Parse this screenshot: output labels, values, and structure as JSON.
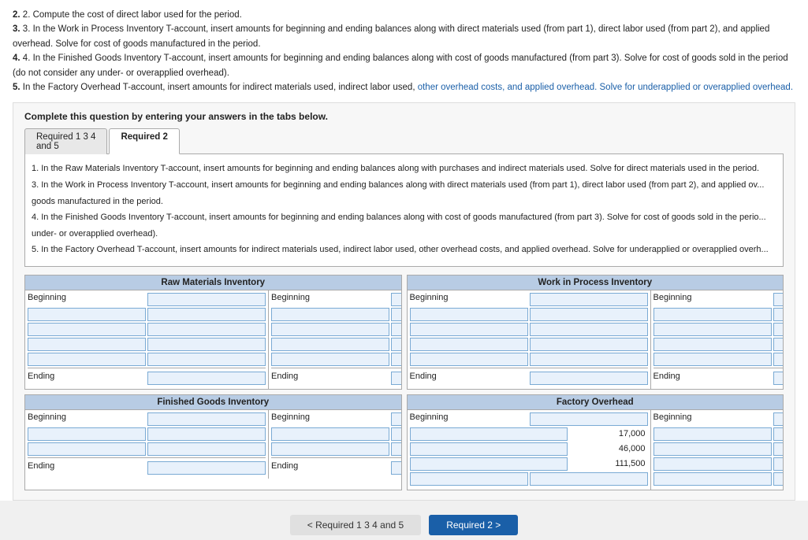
{
  "intro": {
    "line2": "2. Compute the cost of direct labor used for the period.",
    "line3": "3. In the Work in Process Inventory T-account, insert amounts for beginning and ending balances along with direct materials used (from part 1), direct labor used (from part 2), and applied overhead. Solve for cost of goods manufactured in the period.",
    "line4": "4. In the Finished Goods Inventory T-account, insert amounts for beginning and ending balances along with cost of goods manufactured (from part 3). Solve for cost of goods sold in the period (do not consider any under- or overapplied overhead).",
    "line5_start": "5. In the Factory Overhead T-account, insert amounts for indirect materials used, indirect labor used, ",
    "line5_blue": "other overhead costs, and applied overhead.",
    "line5_end": " Solve for underapplied or overapplied overhead."
  },
  "complete": {
    "label": "Complete this question by entering your answers in the tabs below."
  },
  "tabs": {
    "tab1": {
      "label": "Required 1 3 4\nand 5",
      "id": "tab1"
    },
    "tab2": {
      "label": "Required 2",
      "id": "tab2",
      "active": true
    }
  },
  "tab_content": {
    "line1": "1. In the Raw Materials Inventory T-account, insert amounts for beginning and ending balances along with purchases and indirect materials used. Solve for direct materials used in the period.",
    "line3": "3. In the Work in Process Inventory T-account, insert amounts for beginning and ending balances along with direct materials used (from part 1), direct labor used (from part 2), and applied ov...",
    "line4": "goods manufactured in the period.",
    "line4b": "4. In the Finished Goods Inventory T-account, insert amounts for beginning and ending balances along with cost of goods manufactured (from part 3). Solve for cost of goods sold in the perio...",
    "line5": "under- or overapplied overhead).",
    "line5b": "5. In the Factory Overhead T-account, insert amounts for indirect materials used, indirect labor used, other overhead costs, and applied overhead. Solve for underapplied or overapplied overh..."
  },
  "t_accounts": {
    "raw_materials": {
      "title": "Raw Materials Inventory",
      "left_label1": "Beginning",
      "right_label1": "Beginning",
      "left_label_end": "Ending",
      "right_label_end": "Ending"
    },
    "work_in_process": {
      "title": "Work in Process Inventory",
      "left_label1": "Beginning",
      "right_label1": "Beginning",
      "left_label_end": "Ending",
      "right_label_end": "Ending"
    },
    "finished_goods": {
      "title": "Finished Goods Inventory",
      "left_label1": "Beginning",
      "right_label1": "Beginning",
      "left_label_end": "Ending",
      "right_label_end": "Ending"
    },
    "factory_overhead": {
      "title": "Factory Overhead",
      "left_label1": "Beginning",
      "right_label1": "Beginning",
      "val1": "17,000",
      "val2": "46,000",
      "val3": "111,500",
      "left_label_end": "",
      "right_label_end": ""
    }
  },
  "footer": {
    "prev_label": "< Required 1 3 4 and 5",
    "next_label": "Required 2 >"
  }
}
